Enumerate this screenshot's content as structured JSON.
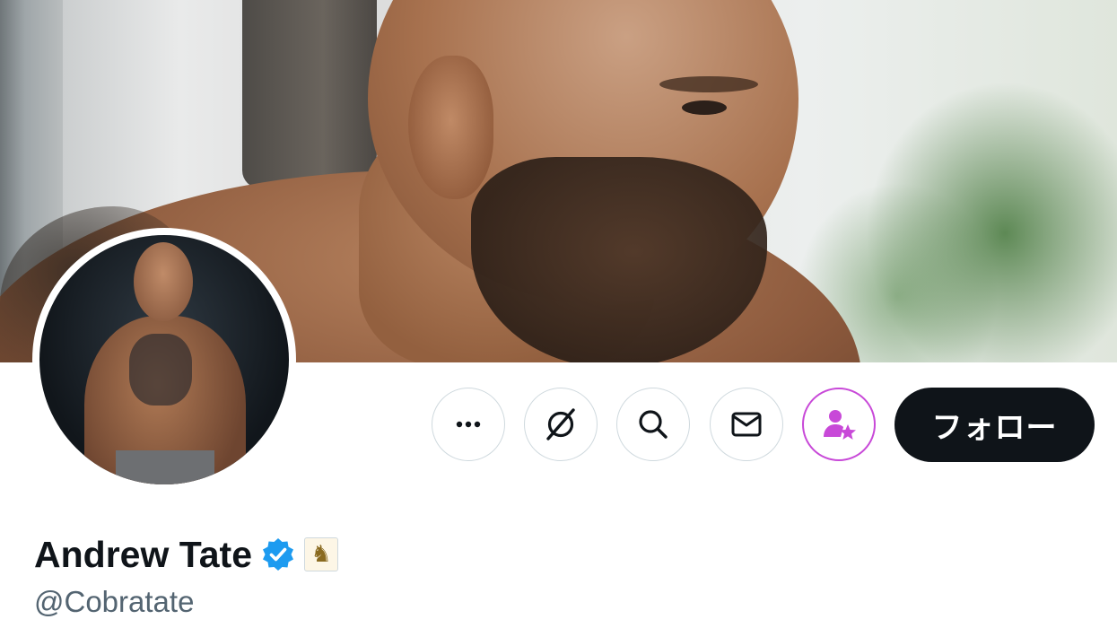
{
  "profile": {
    "display_name": "Andrew Tate",
    "handle": "@Cobratate",
    "verified": true,
    "affiliate_badge_glyph": "♞"
  },
  "actions": {
    "more_icon": "more-horizontal-icon",
    "grok_icon": "grok-icon",
    "search_icon": "search-icon",
    "message_icon": "envelope-icon",
    "subscribe_icon": "person-star-icon",
    "follow_label": "フォロー"
  },
  "colors": {
    "follow_button_bg": "#0f1419",
    "follow_button_text": "#ffffff",
    "verified_blue": "#1d9bf0",
    "subscribe_accent": "#c849d8",
    "handle_gray": "#536471",
    "button_border": "#cfd9de"
  }
}
